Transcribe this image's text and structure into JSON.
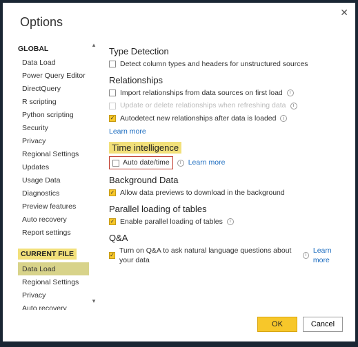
{
  "dialog": {
    "title": "Options",
    "close_glyph": "✕"
  },
  "sidebar": {
    "global_header": "GLOBAL",
    "current_file_header": "CURRENT FILE",
    "global_items": [
      "Data Load",
      "Power Query Editor",
      "DirectQuery",
      "R scripting",
      "Python scripting",
      "Security",
      "Privacy",
      "Regional Settings",
      "Updates",
      "Usage Data",
      "Diagnostics",
      "Preview features",
      "Auto recovery",
      "Report settings"
    ],
    "current_file_items": [
      "Data Load",
      "Regional Settings",
      "Privacy",
      "Auto recovery"
    ],
    "selected": "Data Load",
    "scroll_up": "▴",
    "scroll_down": "▾"
  },
  "content": {
    "type_detection": {
      "title": "Type Detection",
      "opt1": "Detect column types and headers for unstructured sources"
    },
    "relationships": {
      "title": "Relationships",
      "opt1": "Import relationships from data sources on first load",
      "opt2": "Update or delete relationships when refreshing data",
      "opt3": "Autodetect new relationships after data is loaded",
      "learn_more": "Learn more"
    },
    "time_intelligence": {
      "title": "Time intelligence",
      "opt1": "Auto date/time",
      "learn_more": "Learn more"
    },
    "background_data": {
      "title": "Background Data",
      "opt1": "Allow data previews to download in the background"
    },
    "parallel": {
      "title": "Parallel loading of tables",
      "opt1": "Enable parallel loading of tables"
    },
    "qa": {
      "title": "Q&A",
      "opt1": "Turn on Q&A to ask natural language questions about your data",
      "learn_more": "Learn more"
    },
    "info_glyph": "i",
    "check_glyph": "✓"
  },
  "footer": {
    "ok": "OK",
    "cancel": "Cancel"
  }
}
